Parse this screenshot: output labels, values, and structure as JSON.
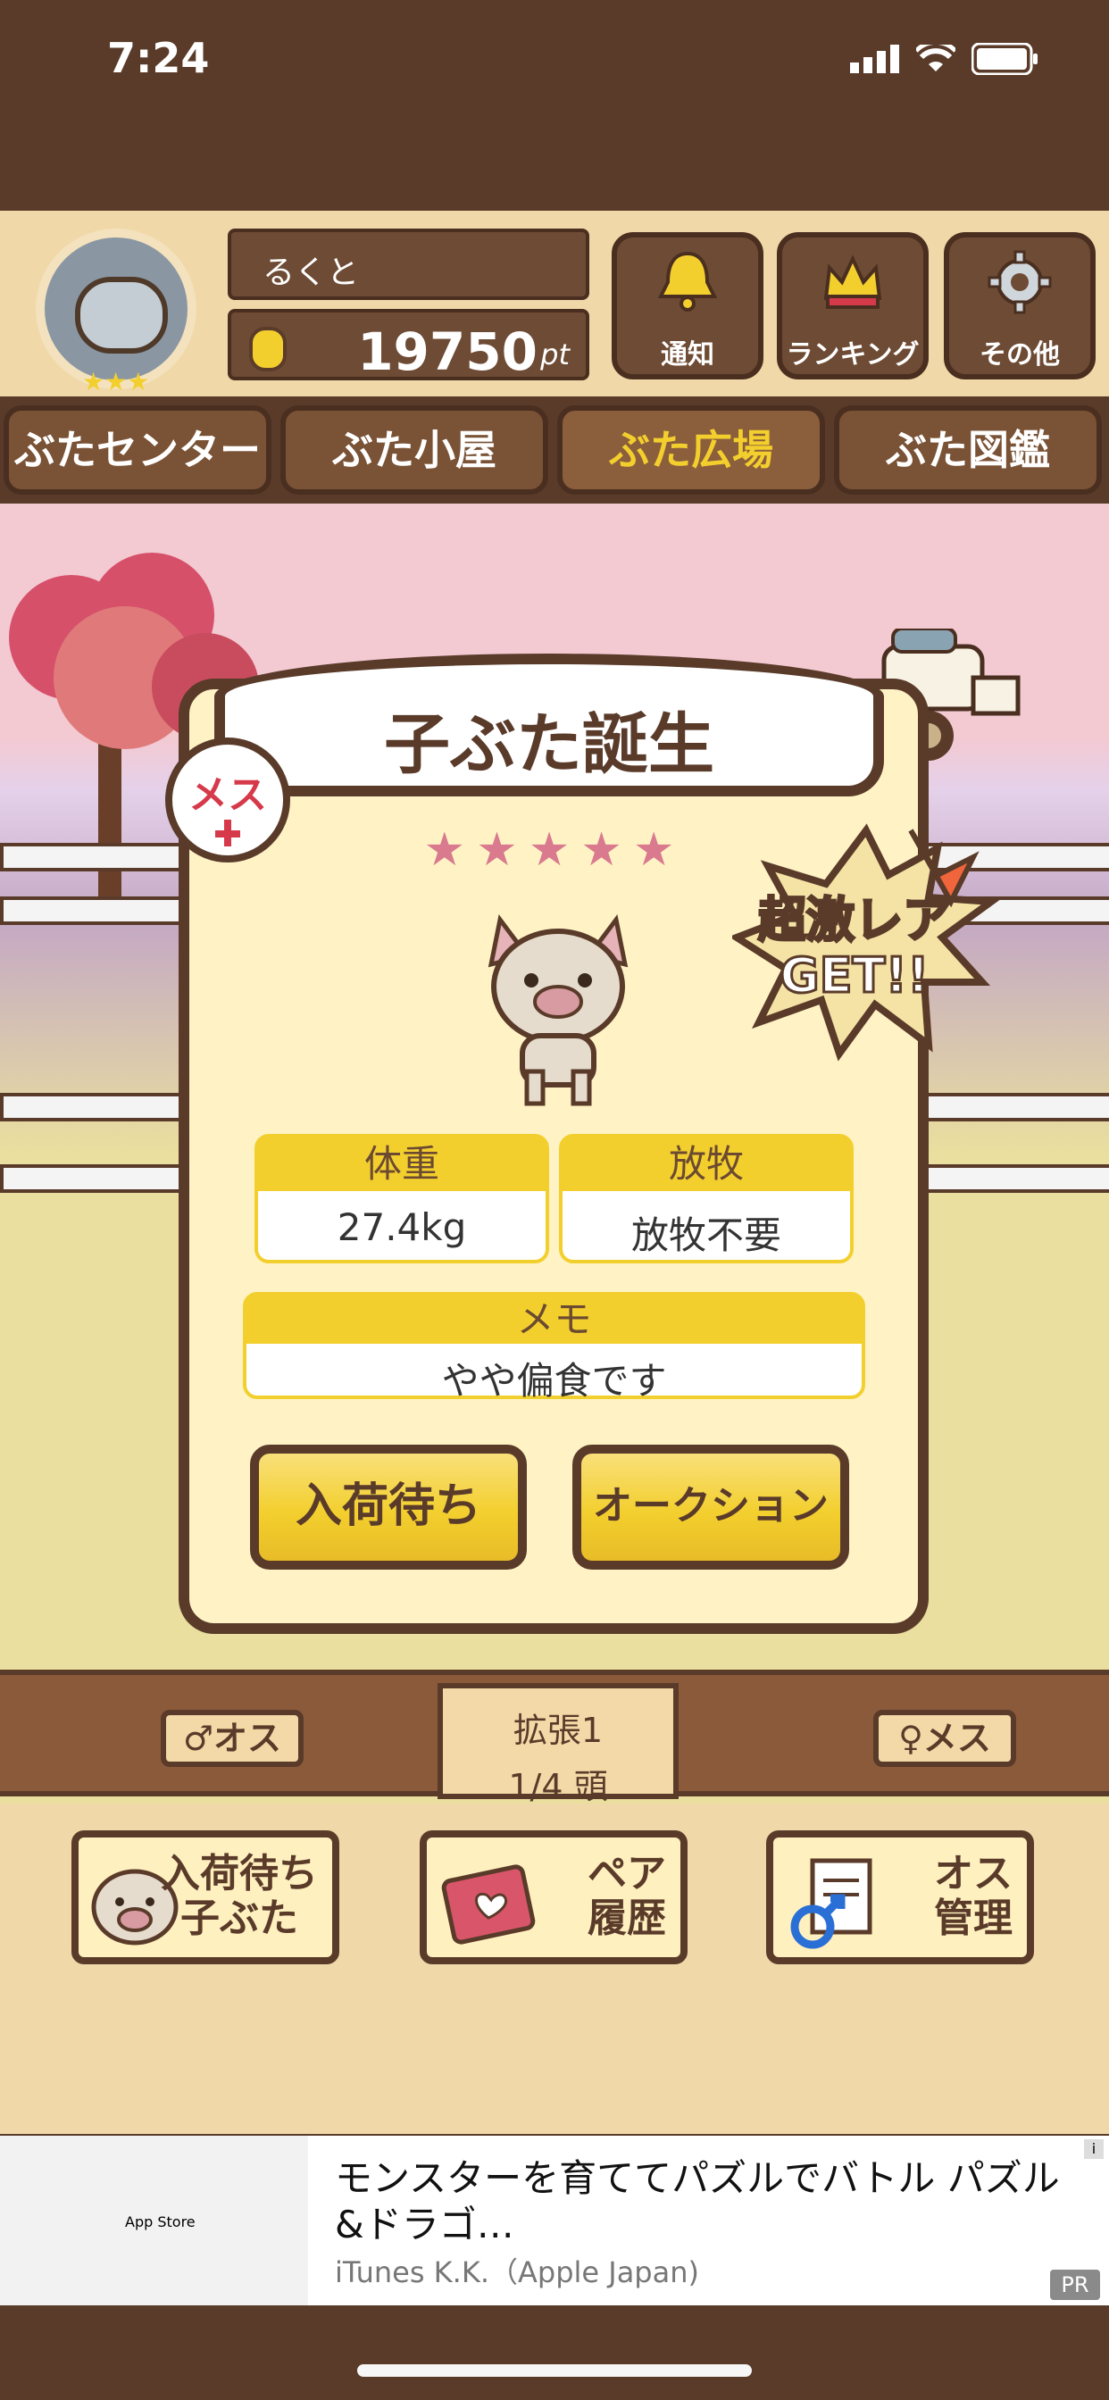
{
  "status_bar": {
    "time": "7:24"
  },
  "header": {
    "user_name": "るくと",
    "points": "19750",
    "points_unit": "pt",
    "buttons": [
      {
        "label": "通知",
        "icon": "bell-icon"
      },
      {
        "label": "ランキング",
        "icon": "crown-icon"
      },
      {
        "label": "その他",
        "icon": "gear-icon"
      }
    ]
  },
  "tabs": [
    {
      "label": "ぶたセンター",
      "active": false
    },
    {
      "label": "ぶた小屋",
      "active": false
    },
    {
      "label": "ぶた広場",
      "active": true
    },
    {
      "label": "ぶた図鑑",
      "active": false
    }
  ],
  "card": {
    "title": "子ぶた誕生",
    "gender": "メス",
    "stars": "★★★★★",
    "rare_badge": "超激レア GET!!",
    "stats": [
      {
        "label": "体重",
        "value": "27.4kg"
      },
      {
        "label": "放牧",
        "value": "放牧不要"
      }
    ],
    "memo_label": "メモ",
    "memo_value": "やや偏食です",
    "buttons": {
      "left": "入荷待ち",
      "right": "オークション"
    }
  },
  "signs": {
    "male": "♂オス",
    "female": "♀メス",
    "expand_line1": "拡張1",
    "expand_line2": "1/4 頭"
  },
  "bottom_buttons": [
    {
      "label_line1": "入荷待ち",
      "label_line2": "子ぶた"
    },
    {
      "label_line1": "ペア",
      "label_line2": "履歴"
    },
    {
      "label_line1": "オス",
      "label_line2": "管理"
    }
  ],
  "ad": {
    "thumb_text": "App Store",
    "title": "モンスターを育ててパズルでバトル パズル&ドラゴ…",
    "subtitle": "iTunes K.K.（Apple Japan)",
    "pr": "PR",
    "info": "i"
  },
  "colors": {
    "dark_brown": "#5a3b2a",
    "yellow": "#f3cf2e",
    "cream": "#fff3c6",
    "pink_star": "#d97a8e",
    "red_gender": "#d63a4a"
  }
}
